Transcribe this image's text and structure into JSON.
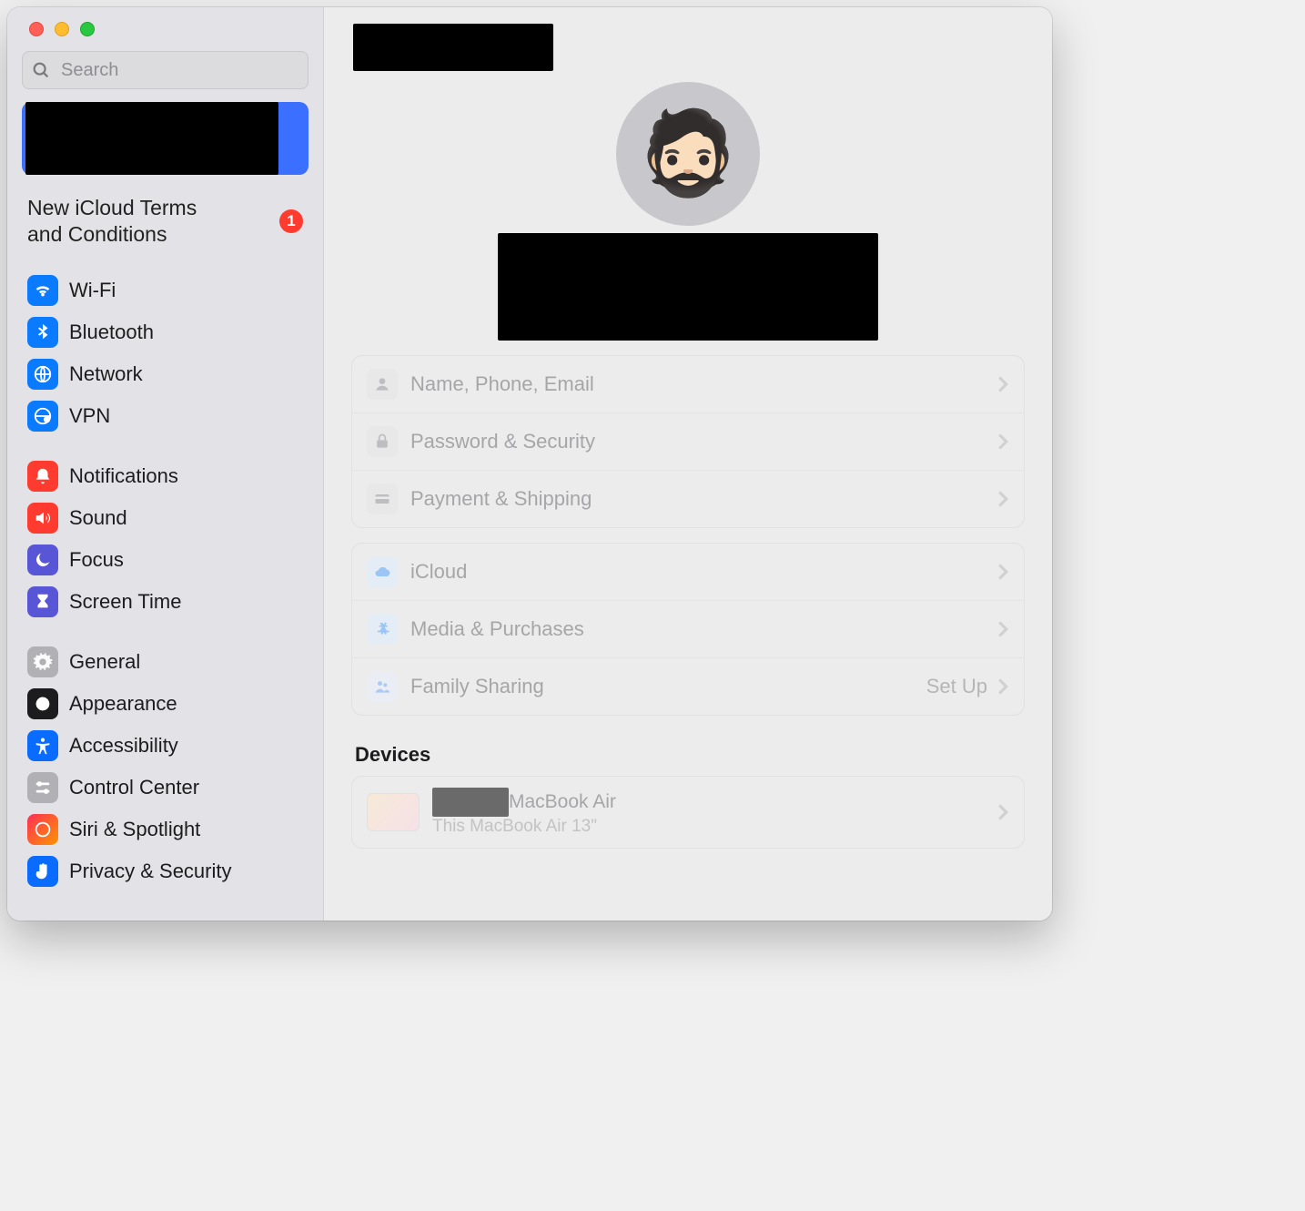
{
  "search": {
    "placeholder": "Search"
  },
  "sidebar": {
    "notice": {
      "text": "New iCloud Terms and Conditions",
      "badge": "1"
    },
    "group1": [
      {
        "label": "Wi-Fi"
      },
      {
        "label": "Bluetooth"
      },
      {
        "label": "Network"
      },
      {
        "label": "VPN"
      }
    ],
    "group2": [
      {
        "label": "Notifications"
      },
      {
        "label": "Sound"
      },
      {
        "label": "Focus"
      },
      {
        "label": "Screen Time"
      }
    ],
    "group3": [
      {
        "label": "General"
      },
      {
        "label": "Appearance"
      },
      {
        "label": "Accessibility"
      },
      {
        "label": "Control Center"
      },
      {
        "label": "Siri & Spotlight"
      },
      {
        "label": "Privacy & Security"
      }
    ]
  },
  "main": {
    "account_rows": [
      {
        "label": "Name, Phone, Email"
      },
      {
        "label": "Password & Security"
      },
      {
        "label": "Payment & Shipping"
      }
    ],
    "service_rows": [
      {
        "label": "iCloud"
      },
      {
        "label": "Media & Purchases"
      },
      {
        "label": "Family Sharing",
        "trail": "Set Up"
      }
    ],
    "devices_title": "Devices",
    "device": {
      "title_suffix": "MacBook Air",
      "subtitle": "This MacBook Air 13\""
    }
  }
}
